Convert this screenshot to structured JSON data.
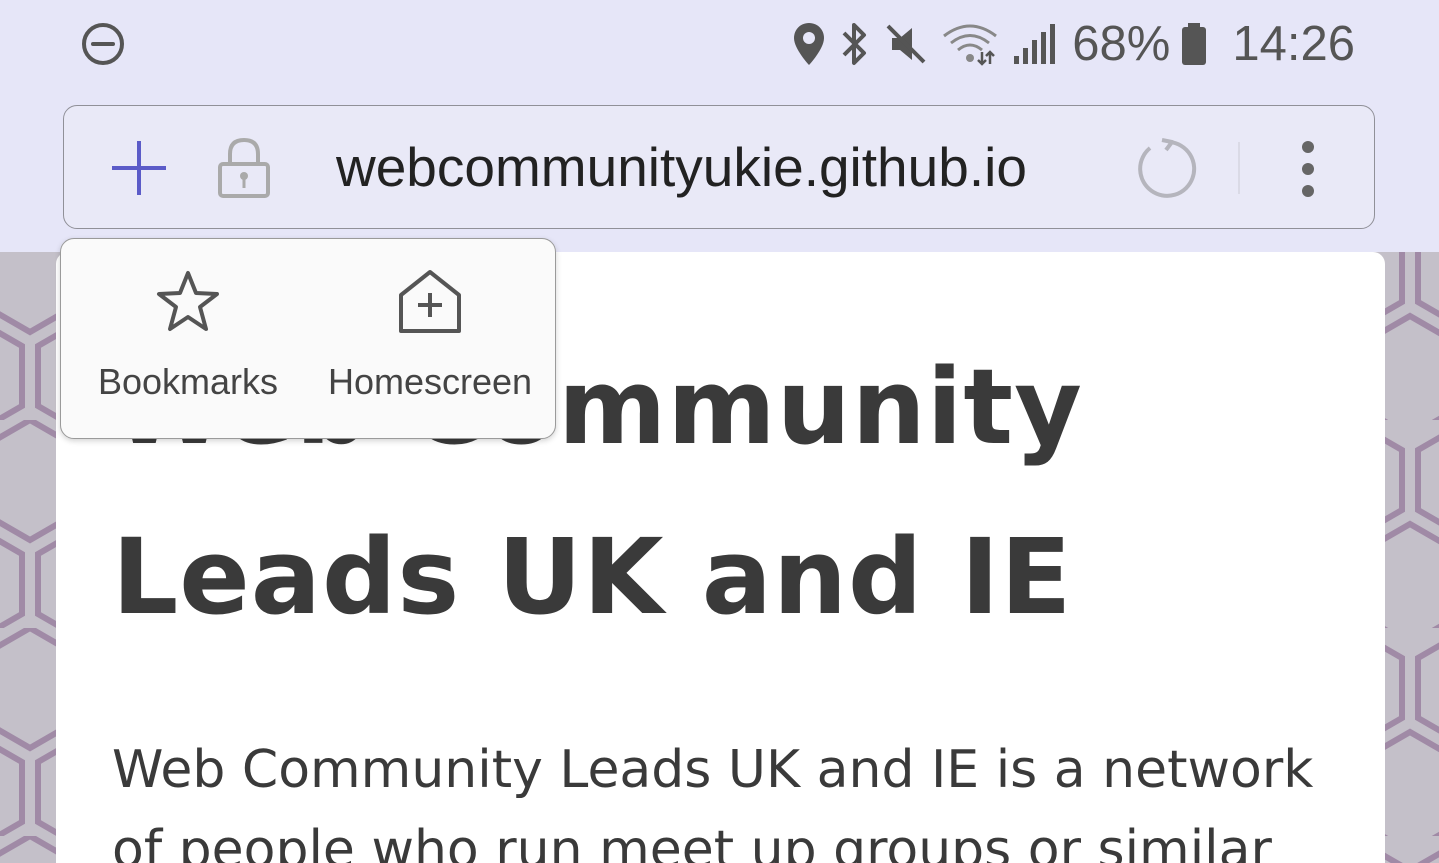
{
  "status_bar": {
    "battery_percent": "68%",
    "time": "14:26",
    "icons": [
      "do-not-disturb-icon",
      "location-icon",
      "bluetooth-icon",
      "mute-icon",
      "wifi-icon",
      "signal-icon",
      "battery-icon"
    ]
  },
  "browser": {
    "url": "webcommunityukie.github.io",
    "icons": [
      "plus-icon",
      "lock-icon",
      "reload-icon",
      "more-vertical-icon"
    ],
    "accent_color": "#5b5bc8"
  },
  "popup": {
    "items": [
      {
        "label": "Bookmarks",
        "icon": "star-icon"
      },
      {
        "label": "Homescreen",
        "icon": "add-home-icon"
      }
    ]
  },
  "page": {
    "heading": "Web Community Leads UK and IE",
    "paragraph": "Web Community Leads UK and IE is a network of people who run meet up groups or similar"
  },
  "colors": {
    "chrome_background": "#e6e6f8",
    "page_text": "#3a3a3a",
    "hex_pattern": "#a08aa6"
  }
}
